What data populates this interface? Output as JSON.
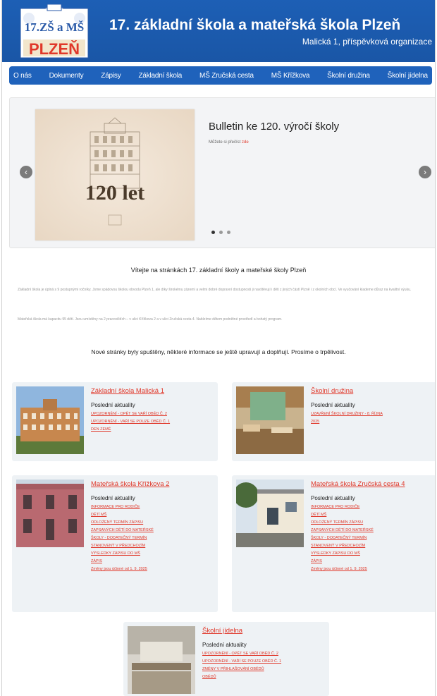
{
  "header": {
    "logo_top": "17.ZŠ a MŠ",
    "logo_bottom": "PLZEŇ",
    "title": "17. základní škola a mateřská škola Plzeň",
    "subtitle": "Malická 1, příspěvková organizace"
  },
  "nav": {
    "items": [
      "O nás",
      "Dokumenty",
      "Zápisy",
      "Základní škola",
      "MŠ Zručská cesta",
      "MŠ Křížkova",
      "Školní družina",
      "Školní jídelna"
    ]
  },
  "slider": {
    "image_text": "120 let",
    "title": "Bulletin ke 120. výročí školy",
    "more_prefix": "Můžete si přečíst ",
    "more_link": "zde",
    "active_dot": 1
  },
  "welcome": {
    "title": "Vítejte na stránkách 17. základní školy a mateřské školy Plzeň",
    "p1": "Základní škola je úplná s 9 postupnými ročníky. Jsme spádovou školou obvodu Plzeň 1, ale díky širokému zázemí a velmi dobré dopravní dostupnosti ji navštěvují i děti z jiných částí Plzně i z okolních obcí. Ve vyučování klademe důraz na kvalitní výuku.",
    "p2": "Mateřská škola má kapacitu 95 dětí. Jsou umístěny na 2 pracovištích – v ulici Křížkova 2 a v ulici Zručská cesta 4. Nabízíme dětem podnětné prostředí a bohatý program.",
    "note": "Nové stránky byly spuštěny, některé informace se ještě upravují a doplňují. Prosíme o trpělivost."
  },
  "cards": [
    {
      "title": "Základní škola Malická 1",
      "subtitle": "Poslední aktuality",
      "links": [
        "UPOZORNĚNÍ - OPĚT SE VAŘÍ OBĚD Č. 2",
        "UPOZORNĚNÍ - VAŘÍ SE POUZE OBĚD Č. 1",
        "DEN ZEMĚ"
      ]
    },
    {
      "title": "Školní družina",
      "subtitle": "Poslední aktuality",
      "links": [
        "UZAVŘENÍ ŠKOLNÍ DRUŽINY - 8. ŘÍJNA",
        "2025"
      ]
    },
    {
      "title": "Mateřská škola Křížkova 2",
      "subtitle": "Poslední aktuality",
      "links": [
        "INFORMACE PRO RODIČE",
        "DĚTÍ MŠ",
        "ODLOŽENÝ TERMÍN ZÁPISU",
        "ZAPSANÝCH DĚTÍ DO MATEŘSKÉ",
        "ŠKOLY - DODATEČNÝ TERMÍN",
        "STANOVENÝ V PŘEDCHOZÍM",
        "VÝSLEDKY ZÁPISU DO MŠ",
        "ZÁPIS"
      ],
      "footer": "Změny jsou účinné od 1. 9. 2025"
    },
    {
      "title": "Mateřská škola Zručská cesta 4",
      "subtitle": "Poslední aktuality",
      "links": [
        "INFORMACE PRO RODIČE",
        "DĚTÍ MŠ",
        "ODLOŽENÝ TERMÍN ZÁPISU",
        "ZAPSANÝCH DĚTÍ DO MATEŘSKÉ",
        "ŠKOLY - DODATEČNÝ TERMÍN",
        "STANOVENÝ V PŘEDCHOZÍM",
        "VÝSLEDKY ZÁPISU DO MŠ",
        "ZÁPIS"
      ],
      "footer": "Změny jsou účinné od 1. 9. 2025"
    },
    {
      "title": "Školní jídelna",
      "subtitle": "Poslední aktuality",
      "links": [
        "UPOZORNĚNÍ - OPĚT SE VAŘÍ OBĚD Č. 2",
        "UPOZORNĚNÍ - VAŘÍ SE POUZE OBĚD Č. 1",
        "ZMĚNY V PŘIHLAŠOVÁNÍ OBĚDŮ",
        "OBĚDŮ"
      ]
    }
  ],
  "colors": {
    "header_blue": "#1a56a6",
    "nav_blue": "#1f62bb",
    "link_red": "#e0382a",
    "card_bg": "#eef2f5"
  },
  "icons": {
    "slider_prev": "chevron-left-icon",
    "slider_next": "chevron-right-icon"
  }
}
